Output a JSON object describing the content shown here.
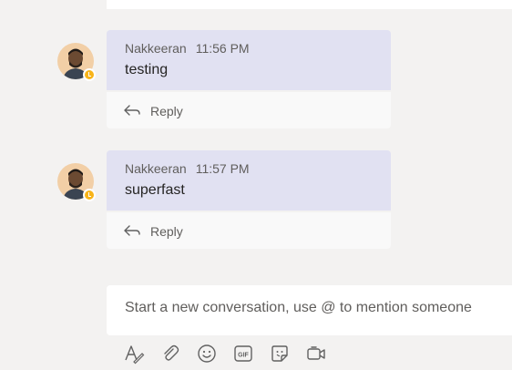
{
  "messages": [
    {
      "author": "Nakkeeran",
      "time": "11:56 PM",
      "text": "testing",
      "reply_label": "Reply"
    },
    {
      "author": "Nakkeeran",
      "time": "11:57 PM",
      "text": "superfast",
      "reply_label": "Reply"
    }
  ],
  "compose": {
    "placeholder": "Start a new conversation, use @ to mention someone"
  },
  "toolbar": {
    "icons": [
      "format-icon",
      "attach-icon",
      "emoji-icon",
      "gif-icon",
      "sticker-icon",
      "meet-now-icon"
    ],
    "gif_text": "GIF"
  },
  "colors": {
    "background": "#f3f2f1",
    "message_bubble": "#e1e1f2",
    "reply_bar": "#f9f9f9",
    "presence_away": "#f8b419",
    "icon": "#616161"
  }
}
